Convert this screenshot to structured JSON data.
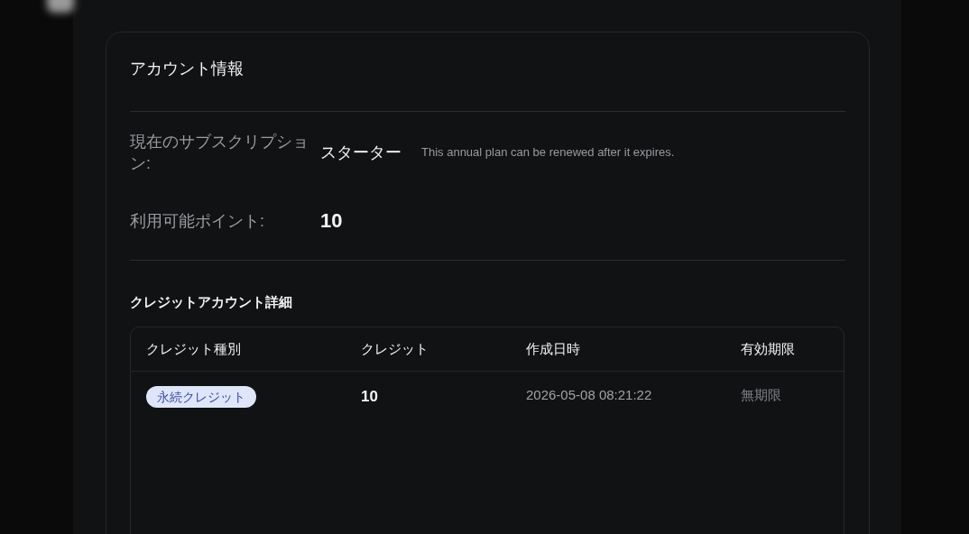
{
  "card": {
    "title": "アカウント情報",
    "fields": [
      {
        "kind": "text",
        "label": "現在のサブスクリプション:",
        "value": "スターター",
        "note": "This annual plan can be renewed after it expires."
      },
      {
        "kind": "number",
        "label": "利用可能ポイント:",
        "value": "10"
      }
    ]
  },
  "credit_details": {
    "title": "クレジットアカウント詳細",
    "columns": [
      "クレジット種別",
      "クレジット",
      "作成日時",
      "有効期限"
    ],
    "rows": [
      {
        "type": "永続クレジット",
        "credits": "10",
        "created": "2026-05-08 08:21:22",
        "expires": "無期限"
      }
    ]
  }
}
